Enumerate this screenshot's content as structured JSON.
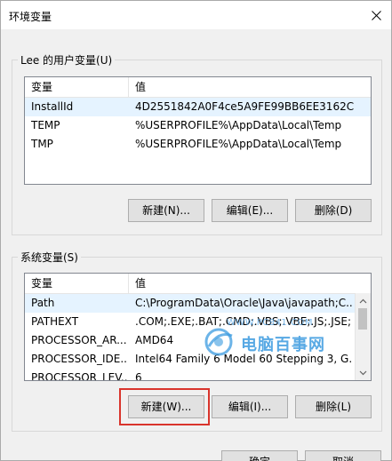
{
  "window": {
    "title": "环境变量"
  },
  "user_vars": {
    "group_label": "Lee 的用户变量(U)",
    "columns": [
      "变量",
      "值"
    ],
    "rows": [
      {
        "name": "InstallId",
        "value": "4D2551842A0F4ce5A9FE99BB6EE3162C"
      },
      {
        "name": "TEMP",
        "value": "%USERPROFILE%\\AppData\\Local\\Temp"
      },
      {
        "name": "TMP",
        "value": "%USERPROFILE%\\AppData\\Local\\Temp"
      }
    ],
    "buttons": {
      "new": "新建(N)...",
      "edit": "编辑(E)...",
      "delete": "删除(D)"
    }
  },
  "system_vars": {
    "group_label": "系统变量(S)",
    "columns": [
      "变量",
      "值"
    ],
    "rows": [
      {
        "name": "Path",
        "value": "C:\\ProgramData\\Oracle\\Java\\javapath;C..."
      },
      {
        "name": "PATHEXT",
        "value": ".COM;.EXE;.BAT;.CMD;.VBS;.VBE;.JS;.JSE;...."
      },
      {
        "name": "PROCESSOR_AR...",
        "value": "AMD64"
      },
      {
        "name": "PROCESSOR_IDE...",
        "value": "Intel64 Family 6 Model 60 Stepping 3, G..."
      },
      {
        "name": "PROCESSOR_LEV...",
        "value": "6"
      }
    ],
    "buttons": {
      "new": "新建(W)...",
      "edit": "编辑(I)...",
      "delete": "删除(L)"
    }
  },
  "footer": {
    "ok": "确定",
    "cancel": "取消"
  },
  "watermark": {
    "url": "WWW.PC841.COM",
    "text": "电脑百事网"
  },
  "colors": {
    "highlight": "#d9342c",
    "selected_row": "#e5f3ff",
    "watermark": "#3b9be0"
  }
}
